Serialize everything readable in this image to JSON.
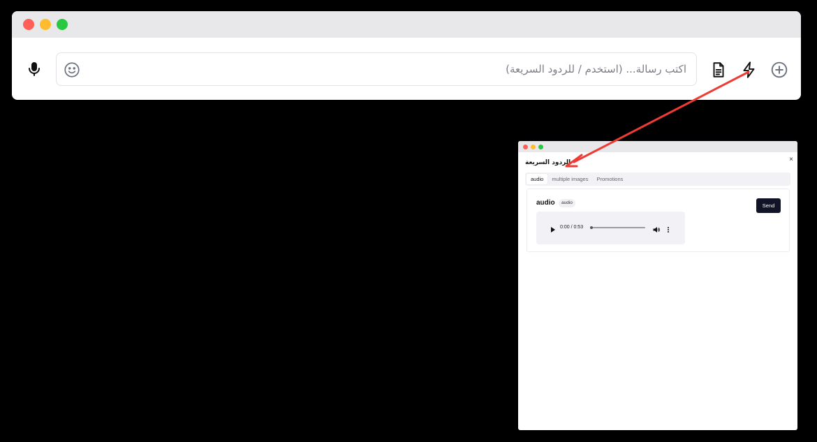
{
  "composer": {
    "placeholder": "اكتب رسالة... (استخدم / للردود السريعة)",
    "icons": {
      "mic": "microphone-icon",
      "emoji": "smile-icon",
      "templates": "document-icon",
      "quick_replies": "lightning-icon",
      "attach": "plus-circle-icon"
    }
  },
  "quick_replies": {
    "title": "الردود السريعة",
    "close_symbol": "×",
    "tabs": [
      {
        "label": "audio",
        "active": true
      },
      {
        "label": "multiple images",
        "active": false
      },
      {
        "label": "Promotions",
        "active": false
      }
    ],
    "items": [
      {
        "title": "audio",
        "badge": "audio",
        "send_label": "Send",
        "player": {
          "time": "0:00 / 0:53",
          "progress": 0
        }
      }
    ]
  },
  "colors": {
    "annotation_arrow": "#ef3b36",
    "send_button": "#101426",
    "traffic_red": "#ff5f57",
    "traffic_yellow": "#febc2e",
    "traffic_green": "#28c840"
  }
}
